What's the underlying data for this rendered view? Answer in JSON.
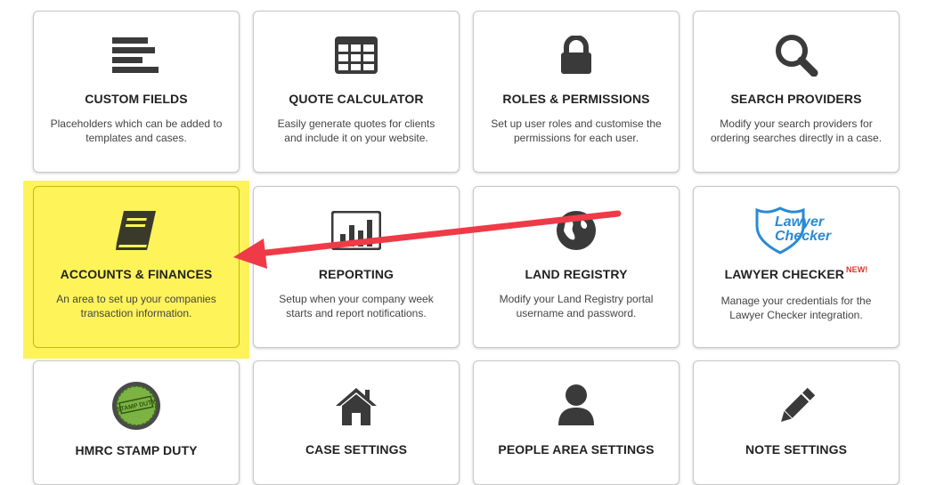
{
  "cards": [
    {
      "title": "CUSTOM FIELDS",
      "desc": "Placeholders which can be added to templates and cases.",
      "icon": "list-icon"
    },
    {
      "title": "QUOTE CALCULATOR",
      "desc": "Easily generate quotes for clients and include it on your website.",
      "icon": "calculator-grid-icon"
    },
    {
      "title": "ROLES & PERMISSIONS",
      "desc": "Set up user roles and customise the permissions for each user.",
      "icon": "padlock-icon"
    },
    {
      "title": "SEARCH PROVIDERS",
      "desc": "Modify your search providers for ordering searches directly in a case.",
      "icon": "search-icon"
    },
    {
      "title": "ACCOUNTS & FINANCES",
      "desc": "An area to set up your companies transaction information.",
      "icon": "book-icon"
    },
    {
      "title": "REPORTING",
      "desc": "Setup when your company week starts and report notifications.",
      "icon": "bar-chart-icon"
    },
    {
      "title": "LAND REGISTRY",
      "desc": "Modify your Land Registry portal username and password.",
      "icon": "globe-icon"
    },
    {
      "title": "LAWYER CHECKER",
      "badge": "NEW!",
      "desc": "Manage your credentials for the Lawyer Checker integration.",
      "icon": "lawyer-checker-logo",
      "logo_text": [
        "Lawyer",
        "Checker"
      ]
    },
    {
      "title": "HMRC STAMP DUTY",
      "desc": "",
      "icon": "stamp-duty-icon",
      "stamp_text": "STAMP DUTY"
    },
    {
      "title": "CASE SETTINGS",
      "desc": "",
      "icon": "house-icon"
    },
    {
      "title": "PEOPLE AREA SETTINGS",
      "desc": "",
      "icon": "person-icon"
    },
    {
      "title": "NOTE SETTINGS",
      "desc": "",
      "icon": "pencil-icon"
    }
  ],
  "colors": {
    "highlight": "#fff35a",
    "arrow": "#ee3b47",
    "icon": "#3a3a3a"
  }
}
